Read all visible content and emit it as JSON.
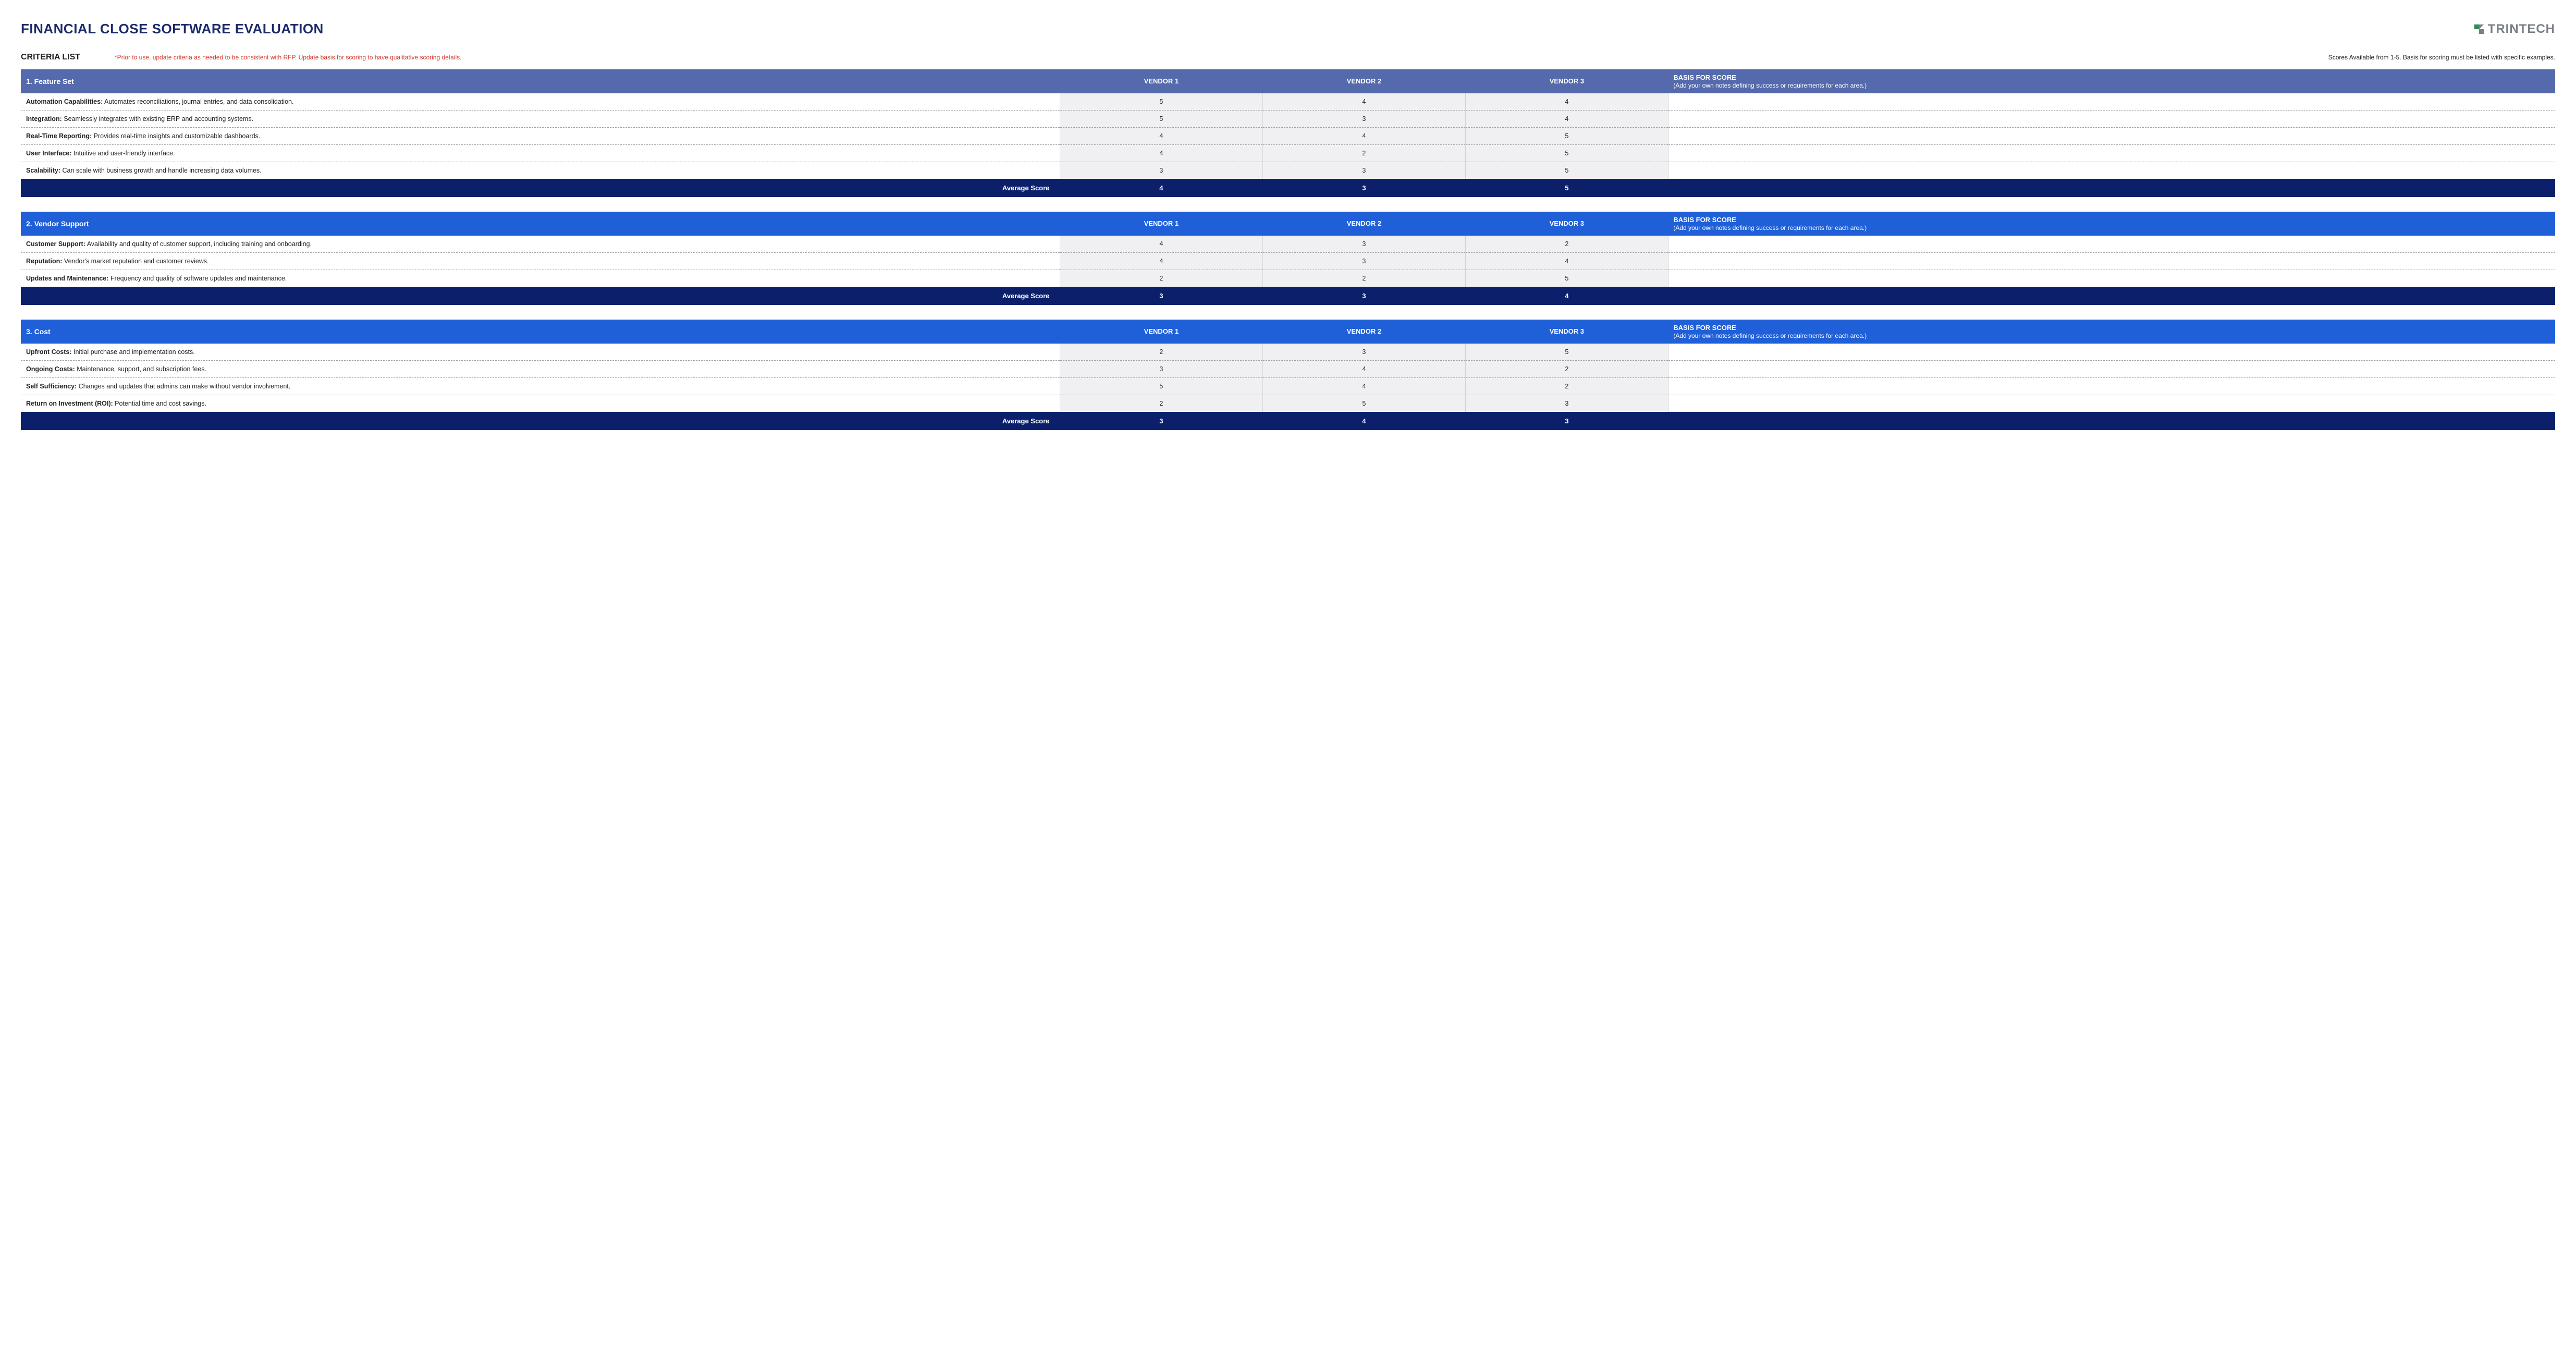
{
  "title": "FINANCIAL CLOSE SOFTWARE EVALUATION",
  "brand": "TRINTECH",
  "criteria_list_label": "CRITERIA LIST",
  "instructions_red": "*Prior to use, update criteria as needed to be consistent with RFP. Update basis for scoring to have qualitative scoring details.",
  "instructions_right": "Scores Available from 1-5. Basis for scoring must be listed with specific examples.",
  "vendor_headers": [
    "VENDOR 1",
    "VENDOR 2",
    "VENDOR 3"
  ],
  "basis_header": "BASIS FOR SCORE",
  "basis_sub": "(Add your own notes defining success or requirements for each area.)",
  "avg_label": "Average Score",
  "sections": [
    {
      "name": "1. Feature Set",
      "rows": [
        {
          "label": "Automation Capabilities:",
          "desc": "Automates reconciliations, journal entries, and data consolidation.",
          "scores": [
            5,
            4,
            4
          ],
          "basis": ""
        },
        {
          "label": "Integration:",
          "desc": "Seamlessly integrates with existing ERP and accounting systems.",
          "scores": [
            5,
            3,
            4
          ],
          "basis": ""
        },
        {
          "label": "Real-Time Reporting:",
          "desc": "Provides real-time insights and customizable dashboards.",
          "scores": [
            4,
            4,
            5
          ],
          "basis": ""
        },
        {
          "label": "User Interface:",
          "desc": "Intuitive and user-friendly interface.",
          "scores": [
            4,
            2,
            5
          ],
          "basis": ""
        },
        {
          "label": "Scalability:",
          "desc": "Can scale with business growth and handle increasing data volumes.",
          "scores": [
            3,
            3,
            5
          ],
          "basis": ""
        }
      ],
      "avg": [
        4,
        3,
        5
      ]
    },
    {
      "name": "2. Vendor Support",
      "rows": [
        {
          "label": "Customer Support:",
          "desc": "Availability and quality of customer support, including training and onboarding.",
          "scores": [
            4,
            3,
            2
          ],
          "basis": ""
        },
        {
          "label": "Reputation:",
          "desc": "Vendor's market reputation and customer reviews.",
          "scores": [
            4,
            3,
            4
          ],
          "basis": ""
        },
        {
          "label": "Updates and Maintenance:",
          "desc": "Frequency and quality of software updates and maintenance.",
          "scores": [
            2,
            2,
            5
          ],
          "basis": ""
        }
      ],
      "avg": [
        3,
        3,
        4
      ]
    },
    {
      "name": "3. Cost",
      "rows": [
        {
          "label": "Upfront Costs:",
          "desc": "Initial purchase and implementation costs.",
          "scores": [
            2,
            3,
            5
          ],
          "basis": ""
        },
        {
          "label": "Ongoing Costs:",
          "desc": "Maintenance, support, and subscription fees.",
          "scores": [
            3,
            4,
            2
          ],
          "basis": ""
        },
        {
          "label": "Self Sufficiency:",
          "desc": "Changes and updates that admins can make without vendor involvement.",
          "scores": [
            5,
            4,
            2
          ],
          "basis": ""
        },
        {
          "label": "Return on Investment (ROI):",
          "desc": "Potential time and cost savings.",
          "scores": [
            2,
            5,
            3
          ],
          "basis": ""
        }
      ],
      "avg": [
        3,
        4,
        3
      ]
    }
  ]
}
